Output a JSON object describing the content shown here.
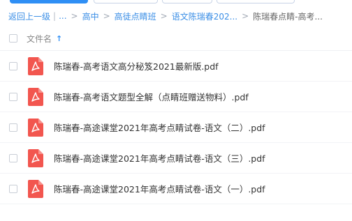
{
  "breadcrumb": {
    "back": "返回上一级",
    "ellipsis": "...",
    "items": [
      "高中",
      "高徒点睛班",
      "语文陈瑞春202..."
    ],
    "current": "陈瑞春点睛-高考..."
  },
  "header": {
    "column_name": "文件名",
    "sort_indicator": "↑"
  },
  "files": [
    {
      "name": "陈瑞春-高考语文高分秘笈2021最新版.pdf",
      "icon": "pdf-icon"
    },
    {
      "name": "陈瑞春-高考语文题型全解（点睛班赠送物料）.pdf",
      "icon": "pdf-icon"
    },
    {
      "name": "陈瑞春-高途课堂2021年高考点睛试卷-语文（二）.pdf",
      "icon": "pdf-icon"
    },
    {
      "name": "陈瑞春-高途课堂2021年高考点睛试卷-语文（三）.pdf",
      "icon": "pdf-icon"
    },
    {
      "name": "陈瑞春-高途课堂2021年高考点睛试卷-语文（一）.pdf",
      "icon": "pdf-icon"
    }
  ],
  "colors": {
    "accent": "#2f8ff5",
    "link": "#3a8ee6",
    "pdf_red": "#f2564f"
  }
}
